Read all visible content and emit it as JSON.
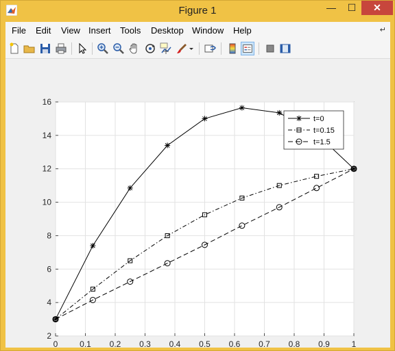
{
  "window": {
    "title": "Figure 1",
    "min_glyph": "—",
    "max_glyph": "☐",
    "close_glyph": "✕"
  },
  "menubar": {
    "items": [
      "File",
      "Edit",
      "View",
      "Insert",
      "Tools",
      "Desktop",
      "Window",
      "Help"
    ],
    "arrow": "↵"
  },
  "toolbar": {
    "icons": [
      "new-figure-icon",
      "open-file-icon",
      "save-icon",
      "print-icon",
      "pointer-icon",
      "zoom-in-icon",
      "zoom-out-icon",
      "pan-icon",
      "rotate-3d-icon",
      "data-cursor-icon",
      "brush-icon",
      "brush-dropdown-icon",
      "link-plot-icon",
      "colorbar-icon",
      "legend-icon",
      "hide-plot-tools-icon",
      "show-plot-tools-icon"
    ],
    "active": "legend-icon"
  },
  "chart_data": {
    "type": "line",
    "xlim": [
      0,
      1
    ],
    "ylim": [
      2,
      16
    ],
    "xticks": [
      "0",
      "0.1",
      "0.2",
      "0.3",
      "0.4",
      "0.5",
      "0.6",
      "0.7",
      "0.8",
      "0.9",
      "1"
    ],
    "yticks": [
      "2",
      "4",
      "6",
      "8",
      "10",
      "12",
      "14",
      "16"
    ],
    "grid": true,
    "legend_position": "top-right",
    "x": [
      0,
      0.125,
      0.25,
      0.375,
      0.5,
      0.625,
      0.75,
      0.875,
      1
    ],
    "series": [
      {
        "name": "t=0",
        "marker": "star",
        "linestyle": "solid",
        "values": [
          3,
          7.4,
          10.85,
          13.4,
          15.0,
          15.65,
          15.35,
          14.1,
          12.0
        ]
      },
      {
        "name": "t=0.15",
        "marker": "square",
        "linestyle": "dashdot",
        "values": [
          3,
          4.8,
          6.5,
          8.0,
          9.25,
          10.25,
          11.0,
          11.55,
          12.0
        ]
      },
      {
        "name": "t=1.5",
        "marker": "circle",
        "linestyle": "dashed",
        "values": [
          3,
          4.15,
          5.25,
          6.35,
          7.45,
          8.6,
          9.7,
          10.85,
          12.0
        ]
      }
    ]
  }
}
